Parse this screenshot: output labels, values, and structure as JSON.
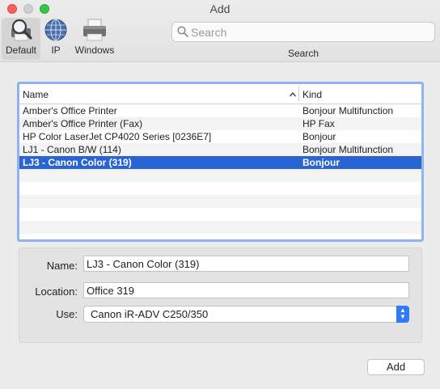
{
  "window": {
    "title": "Add"
  },
  "toolbar": {
    "buttons": [
      {
        "label": "Default",
        "icon": "magnifier-printer-icon"
      },
      {
        "label": "IP",
        "icon": "globe-icon"
      },
      {
        "label": "Windows",
        "icon": "printer-icon"
      }
    ],
    "search": {
      "placeholder": "Search",
      "value": "",
      "label": "Search"
    }
  },
  "list": {
    "columns": {
      "name": "Name",
      "kind": "Kind",
      "sort_indicator": "^"
    },
    "rows": [
      {
        "name": "Amber's Office Printer",
        "kind": "Bonjour Multifunction",
        "selected": false
      },
      {
        "name": "Amber's Office Printer (Fax)",
        "kind": "HP Fax",
        "selected": false
      },
      {
        "name": "HP Color LaserJet CP4020 Series [0236E7]",
        "kind": "Bonjour",
        "selected": false
      },
      {
        "name": "LJ1 - Canon B/W (114)",
        "kind": "Bonjour Multifunction",
        "selected": false
      },
      {
        "name": "LJ3 - Canon Color (319)",
        "kind": "Bonjour",
        "selected": true
      }
    ],
    "selection_color": "#2a64d2",
    "focus_ring_color": "#8fb4f0"
  },
  "details": {
    "name_label": "Name:",
    "name_value": "LJ3 - Canon Color (319)",
    "location_label": "Location:",
    "location_value": "Office 319",
    "use_label": "Use:",
    "use_value": "Canon iR-ADV C250/350"
  },
  "actions": {
    "add_label": "Add"
  }
}
